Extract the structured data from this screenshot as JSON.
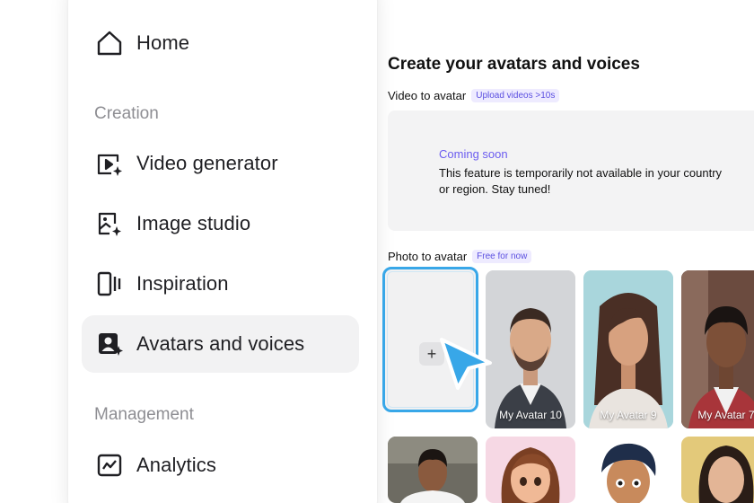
{
  "sidebar": {
    "items": [
      {
        "id": "home",
        "label": "Home",
        "icon": "home-icon"
      },
      {
        "id": "video-generator",
        "label": "Video generator",
        "icon": "video-generator-icon"
      },
      {
        "id": "image-studio",
        "label": "Image studio",
        "icon": "image-studio-icon"
      },
      {
        "id": "inspiration",
        "label": "Inspiration",
        "icon": "inspiration-icon"
      },
      {
        "id": "avatars-and-voices",
        "label": "Avatars and voices",
        "icon": "avatar-icon",
        "active": true
      },
      {
        "id": "analytics",
        "label": "Analytics",
        "icon": "analytics-icon"
      }
    ],
    "sections": {
      "creation": "Creation",
      "management": "Management"
    }
  },
  "main": {
    "title": "Create your avatars and voices",
    "video_to_avatar": {
      "label": "Video to avatar",
      "badge": "Upload videos >10s",
      "notice_title": "Coming soon",
      "notice_text": "This feature is temporarily not available in your country or region. Stay tuned!"
    },
    "photo_to_avatar": {
      "label": "Photo to avatar",
      "badge": "Free for now",
      "upload_symbol": "+",
      "avatars": [
        {
          "name": "My Avatar 10"
        },
        {
          "name": "My Avatar 9"
        },
        {
          "name": "My Avatar 7"
        }
      ]
    }
  },
  "colors": {
    "accent": "#6b5cf0",
    "badge_bg": "#eeebff",
    "upload_border": "#38a7e8",
    "active_bg": "#f2f2f3"
  }
}
